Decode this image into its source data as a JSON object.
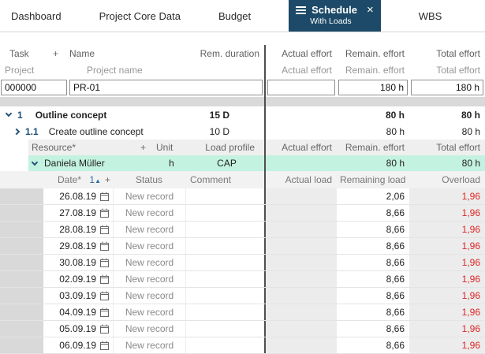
{
  "icons": {
    "close": "×",
    "plus": "+",
    "triangle_up": "▲"
  },
  "colors": {
    "tab_active": "#1c4a68",
    "row_highlight": "#c4f2e0",
    "overload_text": "#e02424",
    "divider": "#4e4e4e"
  },
  "tabs": [
    {
      "label": "Dashboard",
      "active": false
    },
    {
      "label": "Project Core Data",
      "active": false
    },
    {
      "label": "Budget",
      "active": false
    },
    {
      "label": "Schedule",
      "sublabel": "With Loads",
      "active": true
    },
    {
      "label": "WBS",
      "active": false
    }
  ],
  "task_table": {
    "header": {
      "task": "Task",
      "name": "Name",
      "rem_duration": "Rem. duration",
      "actual_effort": "Actual effort",
      "remain_effort": "Remain. effort",
      "total_effort": "Total effort"
    },
    "subheader": {
      "project": "Project",
      "project_name": "Project name",
      "actual_effort": "Actual effort",
      "remain_effort": "Remain. effort",
      "total_effort": "Total effort"
    }
  },
  "project_row": {
    "id": "000000",
    "name": "PR-01",
    "actual_effort": "",
    "remain_effort": "180 h",
    "total_effort": "180 h"
  },
  "tasks": [
    {
      "num": "1",
      "name": "Outline concept",
      "duration": "15 D",
      "remain_effort": "80 h",
      "total_effort": "80 h"
    },
    {
      "num": "1.1",
      "name": "Create outline concept",
      "duration": "10 D",
      "remain_effort": "80 h",
      "total_effort": "80 h"
    }
  ],
  "resource_table": {
    "header": {
      "resource": "Resource*",
      "unit": "Unit",
      "load_profile": "Load profile",
      "actual_effort": "Actual effort",
      "remain_effort": "Remain. effort",
      "total_effort": "Total effort"
    }
  },
  "resource_row": {
    "name": "Daniela Müller",
    "unit": "h",
    "load_profile": "CAP",
    "remain_effort": "80 h",
    "total_effort": "80 h"
  },
  "load_table": {
    "header": {
      "date": "Date*",
      "sort_index": "1",
      "status": "Status",
      "comment": "Comment",
      "actual_load": "Actual load",
      "remaining_load": "Remaining load",
      "overload": "Overload"
    }
  },
  "load_rows": [
    {
      "date": "26.08.19",
      "status": "New record",
      "actual_load": "",
      "remaining_load": "2,06",
      "overload": "1,96"
    },
    {
      "date": "27.08.19",
      "status": "New record",
      "actual_load": "",
      "remaining_load": "8,66",
      "overload": "1,96"
    },
    {
      "date": "28.08.19",
      "status": "New record",
      "actual_load": "",
      "remaining_load": "8,66",
      "overload": "1,96"
    },
    {
      "date": "29.08.19",
      "status": "New record",
      "actual_load": "",
      "remaining_load": "8,66",
      "overload": "1,96"
    },
    {
      "date": "30.08.19",
      "status": "New record",
      "actual_load": "",
      "remaining_load": "8,66",
      "overload": "1,96"
    },
    {
      "date": "02.09.19",
      "status": "New record",
      "actual_load": "",
      "remaining_load": "8,66",
      "overload": "1,96"
    },
    {
      "date": "03.09.19",
      "status": "New record",
      "actual_load": "",
      "remaining_load": "8,66",
      "overload": "1,96"
    },
    {
      "date": "04.09.19",
      "status": "New record",
      "actual_load": "",
      "remaining_load": "8,66",
      "overload": "1,96"
    },
    {
      "date": "05.09.19",
      "status": "New record",
      "actual_load": "",
      "remaining_load": "8,66",
      "overload": "1,96"
    },
    {
      "date": "06.09.19",
      "status": "New record",
      "actual_load": "",
      "remaining_load": "8,66",
      "overload": "1,96"
    }
  ]
}
